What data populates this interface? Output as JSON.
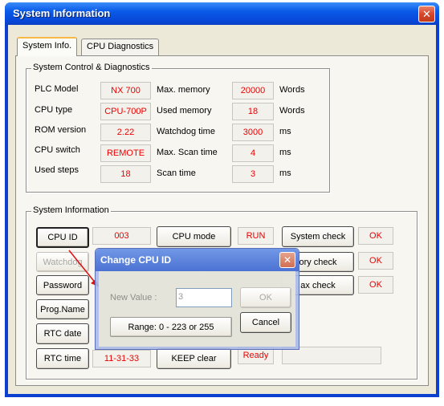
{
  "window": {
    "title": "System Information"
  },
  "tabs": [
    {
      "label": "System Info."
    },
    {
      "label": "CPU Diagnostics"
    }
  ],
  "control_group": {
    "title": "System Control & Diagnostics",
    "rows": [
      {
        "label": "PLC Model",
        "value": "NX 700",
        "label2": "Max. memory",
        "value2": "20000",
        "unit": "Words"
      },
      {
        "label": "CPU type",
        "value": "CPU-700P",
        "label2": "Used memory",
        "value2": "18",
        "unit": "Words"
      },
      {
        "label": "ROM version",
        "value": "2.22",
        "label2": "Watchdog time",
        "value2": "3000",
        "unit": "ms"
      },
      {
        "label": "CPU switch",
        "value": "REMOTE",
        "label2": "Max. Scan time",
        "value2": "4",
        "unit": "ms"
      },
      {
        "label": "Used steps",
        "value": "18",
        "label2": "Scan time",
        "value2": "3",
        "unit": "ms"
      }
    ]
  },
  "info_group": {
    "title": "System Information",
    "cpu_id_button": "CPU ID",
    "cpu_id_value": "003",
    "cpu_mode_button": "CPU mode",
    "cpu_mode_value": "RUN",
    "system_check_button": "System check",
    "system_check_value": "OK",
    "watchdog_button": "Watchdog",
    "memory_check_button": "ory check",
    "memory_check_value": "OK",
    "password_button": "Password",
    "max_check_button": "ax check",
    "max_check_value": "OK",
    "prog_name_button": "Prog.Name",
    "rtc_date_button": "RTC date",
    "rtc_time_button": "RTC time",
    "rtc_time_value": "11-31-33",
    "keep_clear_button": "KEEP clear",
    "keep_clear_value": "Ready"
  },
  "dialog": {
    "title": "Change CPU ID",
    "new_value_label": "New Value :",
    "new_value": "3",
    "ok_button": "OK",
    "cancel_button": "Cancel",
    "range_text": "Range: 0 - 223 or 255"
  }
}
